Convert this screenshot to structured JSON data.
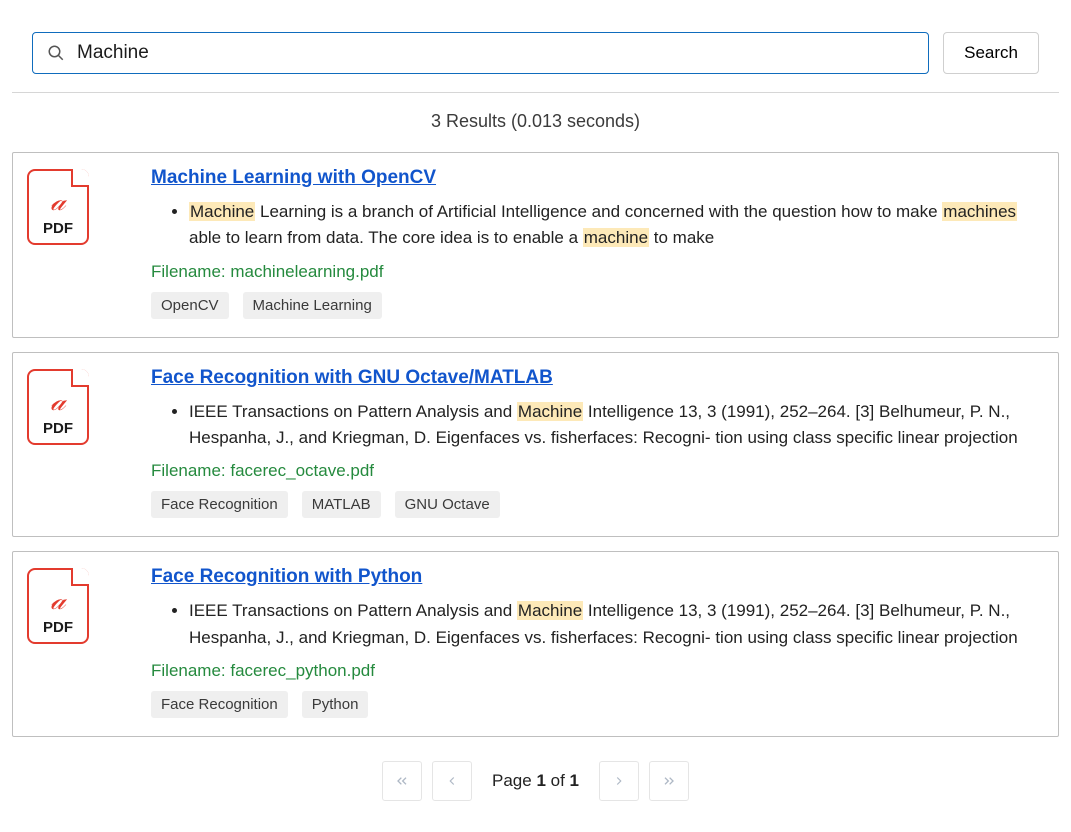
{
  "search": {
    "query": "Machine",
    "button_label": "Search"
  },
  "summary": {
    "count": 3,
    "seconds": "0.013"
  },
  "highlight_terms": [
    "Machine",
    "machine",
    "machines"
  ],
  "results": [
    {
      "title": "Machine Learning with OpenCV",
      "snippet": "Machine Learning is a branch of Artificial Intelligence and concerned with the question how to make machines able to learn from data. The core idea is to enable a machine to make",
      "filename": "machinelearning.pdf",
      "tags": [
        "OpenCV",
        "Machine Learning"
      ]
    },
    {
      "title": "Face Recognition with GNU Octave/MATLAB",
      "snippet": "IEEE Transactions on Pattern Analysis and Machine Intelligence 13, 3 (1991), 252–264. [3] Belhumeur, P. N., Hespanha, J., and Kriegman, D. Eigenfaces vs. fisherfaces: Recogni- tion using class specific linear projection",
      "filename": "facerec_octave.pdf",
      "tags": [
        "Face Recognition",
        "MATLAB",
        "GNU Octave"
      ]
    },
    {
      "title": "Face Recognition with Python",
      "snippet": "IEEE Transactions on Pattern Analysis and Machine Intelligence 13, 3 (1991), 252–264. [3] Belhumeur, P. N., Hespanha, J., and Kriegman, D. Eigenfaces vs. fisherfaces: Recogni- tion using class specific linear projection",
      "filename": "facerec_python.pdf",
      "tags": [
        "Face Recognition",
        "Python"
      ]
    }
  ],
  "pagination": {
    "page": 1,
    "total_pages": 1,
    "prefix": "Page ",
    "separator": " of "
  },
  "labels": {
    "filename_prefix": "Filename: ",
    "pdf": "PDF",
    "results_word": "Results",
    "seconds_word": "seconds"
  }
}
